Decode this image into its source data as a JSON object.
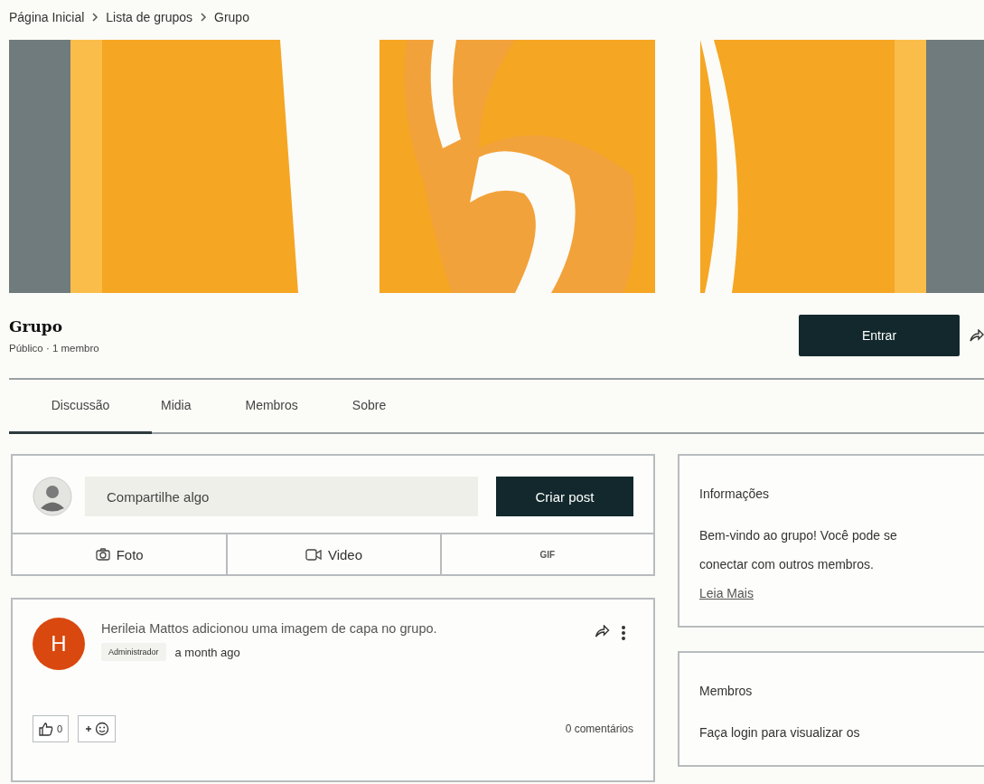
{
  "breadcrumb": [
    "Página Inicial",
    "Lista de grupos",
    "Grupo"
  ],
  "cover": {
    "kind": "picture"
  },
  "group": {
    "title": "Grupo",
    "meta": "Público · 1 membro"
  },
  "join_button": "Entrar",
  "tabs": [
    {
      "label": "Discussão",
      "selected": true
    },
    {
      "label": "Midia",
      "selected": false
    },
    {
      "label": "Membros",
      "selected": false
    },
    {
      "label": "Sobre",
      "selected": false
    }
  ],
  "composer": {
    "placeholder": "Compartilhe algo",
    "button": "Criar post",
    "actions": [
      {
        "label": "Foto"
      },
      {
        "kind": "video",
        "label": "Video"
      },
      {
        "kind": "gif",
        "label": "GIF"
      }
    ]
  },
  "post": {
    "avatar": "H",
    "color": "#d9480f",
    "text": "Herileia Mattos adicionou uma imagem de capa no grupo.",
    "badge": "Administrador",
    "time": "a month ago",
    "likes": "0",
    "comments": "0 comentários"
  },
  "sidebar": [
    {
      "title": "Informações",
      "body": "Bem-vindo ao grupo! Você pode se conectar com outros membros. ",
      "link": "Leia Mais"
    },
    {
      "title": "Membros",
      "body": "Faça login para visualizar os"
    }
  ]
}
